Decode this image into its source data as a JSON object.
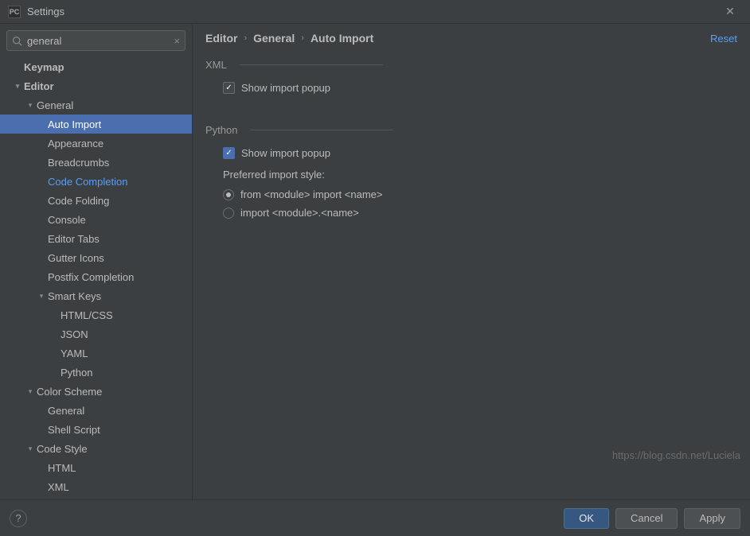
{
  "window": {
    "title": "Settings",
    "icon_text": "PC"
  },
  "search": {
    "value": "general",
    "placeholder": ""
  },
  "tree": [
    {
      "label": "Keymap",
      "indent": 30,
      "bold": true
    },
    {
      "label": "Editor",
      "indent": 16,
      "bold": true,
      "arrow": "down"
    },
    {
      "label": "General",
      "indent": 32,
      "arrow": "down"
    },
    {
      "label": "Auto Import",
      "indent": 60,
      "selected": true
    },
    {
      "label": "Appearance",
      "indent": 60
    },
    {
      "label": "Breadcrumbs",
      "indent": 60
    },
    {
      "label": "Code Completion",
      "indent": 60,
      "highlight": true
    },
    {
      "label": "Code Folding",
      "indent": 60
    },
    {
      "label": "Console",
      "indent": 60
    },
    {
      "label": "Editor Tabs",
      "indent": 60
    },
    {
      "label": "Gutter Icons",
      "indent": 60
    },
    {
      "label": "Postfix Completion",
      "indent": 60
    },
    {
      "label": "Smart Keys",
      "indent": 46,
      "arrow": "down"
    },
    {
      "label": "HTML/CSS",
      "indent": 76
    },
    {
      "label": "JSON",
      "indent": 76
    },
    {
      "label": "YAML",
      "indent": 76
    },
    {
      "label": "Python",
      "indent": 76
    },
    {
      "label": "Color Scheme",
      "indent": 32,
      "arrow": "down"
    },
    {
      "label": "General",
      "indent": 60
    },
    {
      "label": "Shell Script",
      "indent": 60
    },
    {
      "label": "Code Style",
      "indent": 32,
      "arrow": "down"
    },
    {
      "label": "HTML",
      "indent": 60
    },
    {
      "label": "XML",
      "indent": 60
    }
  ],
  "breadcrumb": {
    "a": "Editor",
    "b": "General",
    "c": "Auto Import",
    "reset": "Reset"
  },
  "sections": {
    "xml": {
      "title": "XML",
      "show_popup": {
        "label": "Show import popup",
        "checked": true
      }
    },
    "python": {
      "title": "Python",
      "show_popup": {
        "label": "Show import popup",
        "checked": true
      },
      "style_label": "Preferred import style:",
      "opt1": {
        "label": "from <module> import <name>",
        "checked": true
      },
      "opt2": {
        "label": "import <module>.<name>",
        "checked": false
      }
    }
  },
  "footer": {
    "ok": "OK",
    "cancel": "Cancel",
    "apply": "Apply"
  },
  "watermark": "https://blog.csdn.net/Luciela"
}
